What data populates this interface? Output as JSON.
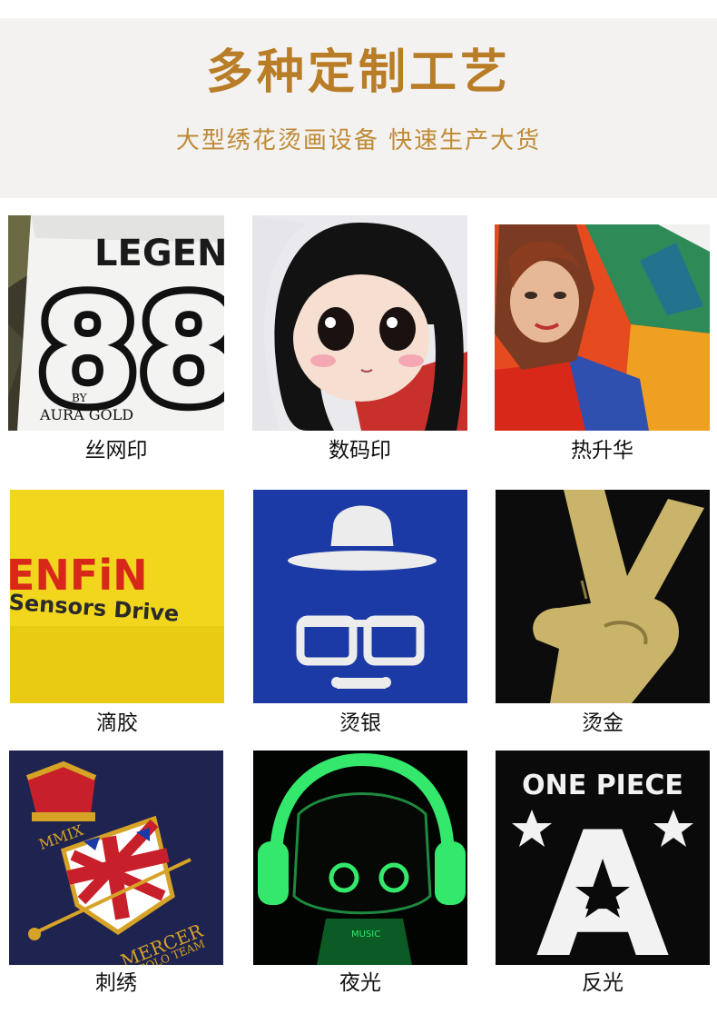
{
  "header": {
    "title": "多种定制工艺",
    "subtitle": "大型绣花烫画设备 快速生产大货"
  },
  "items": [
    {
      "label": "丝网印",
      "art_text_1": "LEGEND",
      "art_text_2": "88",
      "art_text_3": "BY",
      "art_text_4": "AURA GOLD"
    },
    {
      "label": "数码印"
    },
    {
      "label": "热升华"
    },
    {
      "label": "滴胶",
      "art_text_1": "ENFiN",
      "art_text_2": "Sensors Drive"
    },
    {
      "label": "烫银"
    },
    {
      "label": "烫金"
    },
    {
      "label": "刺绣",
      "art_text_1": "MMIX",
      "art_text_2": "MERCER",
      "art_text_3": "EL POLO TEAM"
    },
    {
      "label": "夜光",
      "art_text_1": "MUSIC"
    },
    {
      "label": "反光",
      "art_text_1": "ONE PIECE",
      "art_text_2": "A"
    }
  ],
  "colors": {
    "header_bg": "#f3f2f0",
    "title": "#b87d26",
    "subtitle": "#bf8a35",
    "glow_green": "#34e86b",
    "gold_foil": "#c9b46a",
    "royal_blue": "#1b3aa6",
    "yellow_shirt": "#f2d61e"
  }
}
